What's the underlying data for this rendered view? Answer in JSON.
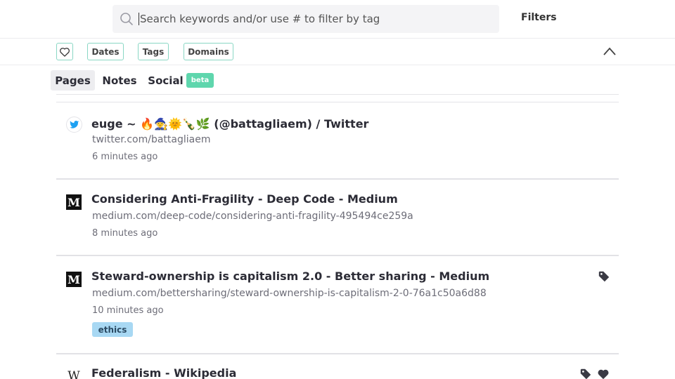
{
  "search": {
    "placeholder": "Search keywords and/or use # to filter by tag",
    "filters_label": "Filters"
  },
  "filter_bar": {
    "chips": [
      {
        "label": "Dates"
      },
      {
        "label": "Tags"
      },
      {
        "label": "Domains"
      }
    ]
  },
  "tabs": {
    "items": [
      {
        "label": "Pages",
        "active": true
      },
      {
        "label": "Notes",
        "active": false
      },
      {
        "label": "Social",
        "active": false
      }
    ],
    "beta_label": "beta"
  },
  "results": [
    {
      "favicon": "twitter-bird-icon",
      "title": "euge ~ 🔥🧙🌞🍾🌿 (@battagliaem) / Twitter",
      "url": "twitter.com/battagliaem",
      "time": "6 minutes ago"
    },
    {
      "favicon": "medium-icon",
      "favicon_letter": "M",
      "title": "Considering Anti-Fragility - Deep Code - Medium",
      "url": "medium.com/deep-code/considering-anti-fragility-495494ce259a",
      "time": "8 minutes ago"
    },
    {
      "favicon": "medium-icon",
      "favicon_letter": "M",
      "title": "Steward-ownership is capitalism 2.0 - Better sharing - Medium",
      "url": "medium.com/bettersharing/steward-ownership-is-capitalism-2-0-76a1c50a6d88",
      "time": "10 minutes ago",
      "tags": [
        "ethics"
      ],
      "actions": [
        "tag-icon"
      ]
    },
    {
      "favicon": "wikipedia-icon",
      "favicon_letter": "W",
      "title": "Federalism - Wikipedia",
      "actions": [
        "tag-icon",
        "heart-icon"
      ]
    }
  ],
  "colors": {
    "chip_border": "#8ad7c4",
    "beta_badge": "#5fd6ad",
    "tag_chip": "#a8d8f3",
    "active_tab_bg": "#ededf0"
  }
}
